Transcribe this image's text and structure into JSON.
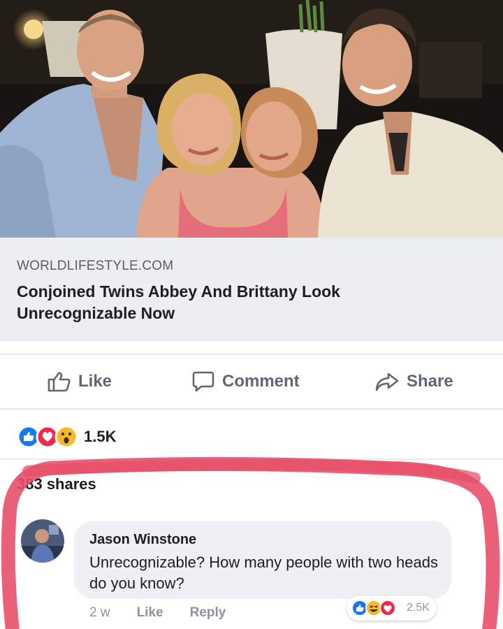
{
  "link": {
    "domain": "WORLDLIFESTYLE.COM",
    "title": "Conjoined Twins Abbey And Brittany Look Unrecognizable Now"
  },
  "actions": {
    "like": "Like",
    "comment": "Comment",
    "share": "Share"
  },
  "reactions": {
    "icons": [
      "like-icon",
      "love-icon",
      "wow-icon"
    ],
    "count": "1.5K"
  },
  "shares": "383 shares",
  "comment": {
    "author": "Jason Winstone",
    "text": "Unrecognizable? How many people with two heads do you know?",
    "time": "2 w",
    "like": "Like",
    "reply": "Reply",
    "reactions": {
      "icons": [
        "like-icon",
        "haha-icon",
        "love-icon"
      ],
      "count": "2.5K"
    }
  },
  "colors": {
    "like_blue": "#1877f2",
    "love_red": "#f0284a",
    "wow_yellow": "#f7b928",
    "highlight": "#e8506a"
  }
}
